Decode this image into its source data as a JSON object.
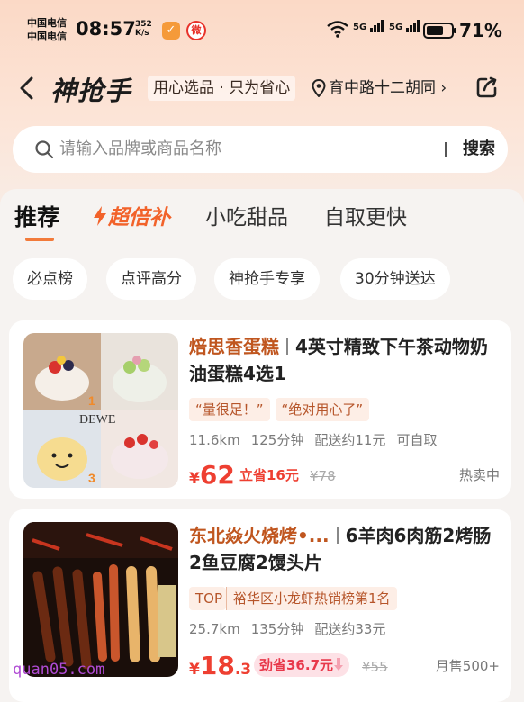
{
  "status_bar": {
    "carrier_1": "中国电信",
    "carrier_2": "中国电信",
    "time": "08:57",
    "speed_value": "352",
    "speed_unit": "K/s",
    "signal_1_label": "5G",
    "signal_2_label": "5G",
    "battery": "71%",
    "battery_level": 0.71
  },
  "header": {
    "logo": "神抢手",
    "slogan": "用心选品 · 只为省心",
    "location": "育中路十二胡同",
    "location_chevron": "›"
  },
  "search": {
    "placeholder": "请输入品牌或商品名称",
    "button": "搜索"
  },
  "tabs": [
    {
      "label": "推荐",
      "active": true
    },
    {
      "label": "超倍补",
      "icon": "lightning-icon"
    },
    {
      "label": "小吃甜品"
    },
    {
      "label": "自取更快"
    }
  ],
  "chips": [
    "必点榜",
    "点评高分",
    "神抢手专享",
    "30分钟送达"
  ],
  "products": [
    {
      "shop": "焙思香蛋糕",
      "name": "4英寸精致下午茶动物奶油蛋糕4选1",
      "tags": [
        "“量很足！”",
        "“绝对用心了”"
      ],
      "distance": "11.6km",
      "time": "125分钟",
      "delivery": "配送约11元",
      "pickup": "可自取",
      "currency": "¥",
      "price": "62",
      "save": "立省16元",
      "original": "¥78",
      "status": "热卖中",
      "image_text": "DEWE"
    },
    {
      "shop": "东北焱火烧烤•...",
      "name": "6羊肉6肉筋2烤肠2鱼豆腐2馒头片",
      "top_tag": "TOP",
      "rank_tag": "裕华区小龙虾热销榜第1名",
      "distance": "25.7km",
      "time": "135分钟",
      "delivery": "配送约33元",
      "currency": "¥",
      "price_int": "18",
      "price_dec": ".3",
      "save": "劲省36.7元",
      "original": "¥55",
      "status": "月售500+"
    }
  ],
  "watermark": "quan05.com",
  "colors": {
    "accent": "#f27a3a",
    "price": "#ee3f31",
    "shop": "#c0561f"
  }
}
